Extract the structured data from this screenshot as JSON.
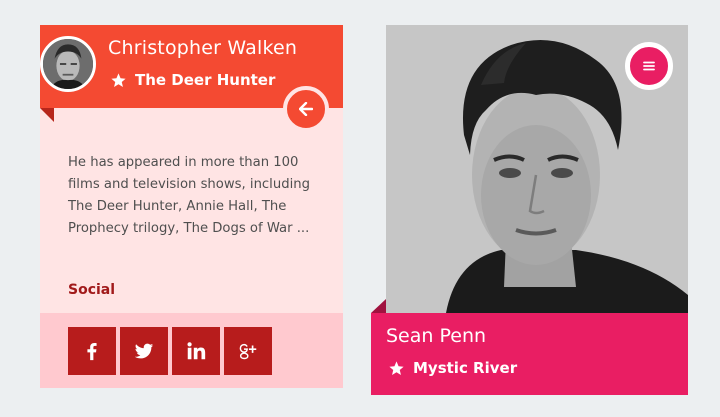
{
  "card1": {
    "name": "Christopher Walken",
    "movie": "The Deer Hunter",
    "bio": "He has appeared in more than 100 films and television shows, including The Deer Hunter, Annie Hall, The Prophecy trilogy, The Dogs of War ...",
    "social_label": "Social",
    "social_icons": [
      "facebook-icon",
      "twitter-icon",
      "linkedin-icon",
      "google-plus-icon"
    ],
    "colors": {
      "header": "#f44a32",
      "body": "#ffe4e4",
      "social_bar": "#ffc9cf",
      "social_button": "#b71c1c",
      "accent_text": "#a1191a"
    }
  },
  "card2": {
    "name": "Sean Penn",
    "movie": "Mystic River",
    "colors": {
      "footer": "#e91e63"
    }
  },
  "background": "#eceff1"
}
